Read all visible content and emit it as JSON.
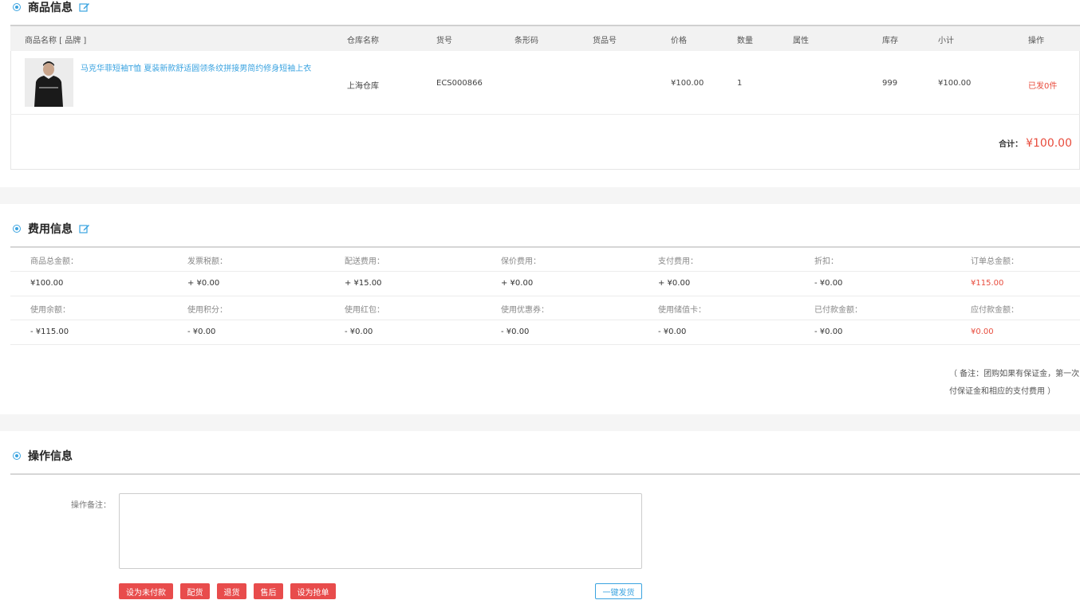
{
  "goods_section": {
    "title": "商品信息",
    "columns": [
      "商品名称 [ 品牌 ]",
      "仓库名称",
      "货号",
      "条形码",
      "货品号",
      "价格",
      "数量",
      "属性",
      "库存",
      "小计",
      "操作"
    ],
    "item": {
      "name": "马克华菲短袖T恤 夏装新款舒适圆领条纹拼接男简约修身短袖上衣",
      "warehouse": "上海仓库",
      "sku": "ECS000866",
      "barcode": "",
      "product_no": "",
      "price": "¥100.00",
      "quantity": "1",
      "attributes": "",
      "stock": "999",
      "subtotal": "¥100.00",
      "action": "已发0件"
    },
    "total_label": "合计：",
    "total_value": "¥100.00"
  },
  "fee_section": {
    "title": "费用信息",
    "row1_labels": [
      "商品总金额：",
      "发票税额：",
      "配送费用：",
      "保价费用：",
      "支付费用：",
      "折扣：",
      "订单总金额："
    ],
    "row1_values": [
      "¥100.00",
      "+ ¥0.00",
      "+ ¥15.00",
      "+ ¥0.00",
      "+ ¥0.00",
      "- ¥0.00",
      "¥115.00"
    ],
    "row2_labels": [
      "使用余额：",
      "使用积分：",
      "使用红包：",
      "使用优惠券：",
      "使用储值卡：",
      "已付款金额：",
      "应付款金额："
    ],
    "row2_values": [
      "- ¥115.00",
      "- ¥0.00",
      "- ¥0.00",
      "- ¥0.00",
      "- ¥0.00",
      "- ¥0.00",
      "¥0.00"
    ],
    "note_line1": "（ 备注：团购如果有保证金，第一次",
    "note_line2": "付保证金和相应的支付费用 ）"
  },
  "ops_section": {
    "title": "操作信息",
    "remark_label": "操作备注：",
    "remark_value": "",
    "buttons": [
      "设为未付款",
      "配货",
      "退货",
      "售后",
      "设为抢单"
    ],
    "ship_button": "一键发货"
  },
  "colors": {
    "accent": "#3aa3e0",
    "danger": "#e84c3d",
    "button_red": "#e84c4c"
  },
  "icons": [
    "radio-dot-icon",
    "edit-icon"
  ]
}
